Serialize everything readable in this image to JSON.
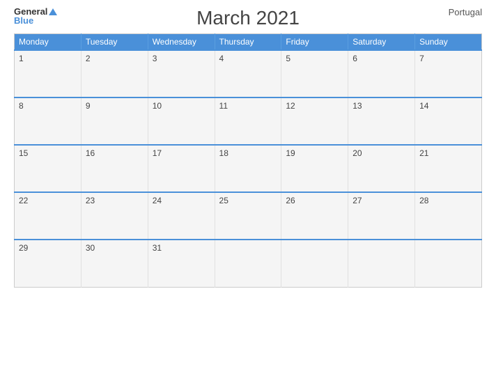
{
  "header": {
    "logo_general": "General",
    "logo_blue": "Blue",
    "title": "March 2021",
    "country": "Portugal"
  },
  "calendar": {
    "days": [
      "Monday",
      "Tuesday",
      "Wednesday",
      "Thursday",
      "Friday",
      "Saturday",
      "Sunday"
    ],
    "weeks": [
      [
        1,
        2,
        3,
        4,
        5,
        6,
        7
      ],
      [
        8,
        9,
        10,
        11,
        12,
        13,
        14
      ],
      [
        15,
        16,
        17,
        18,
        19,
        20,
        21
      ],
      [
        22,
        23,
        24,
        25,
        26,
        27,
        28
      ],
      [
        29,
        30,
        31,
        null,
        null,
        null,
        null
      ]
    ]
  }
}
